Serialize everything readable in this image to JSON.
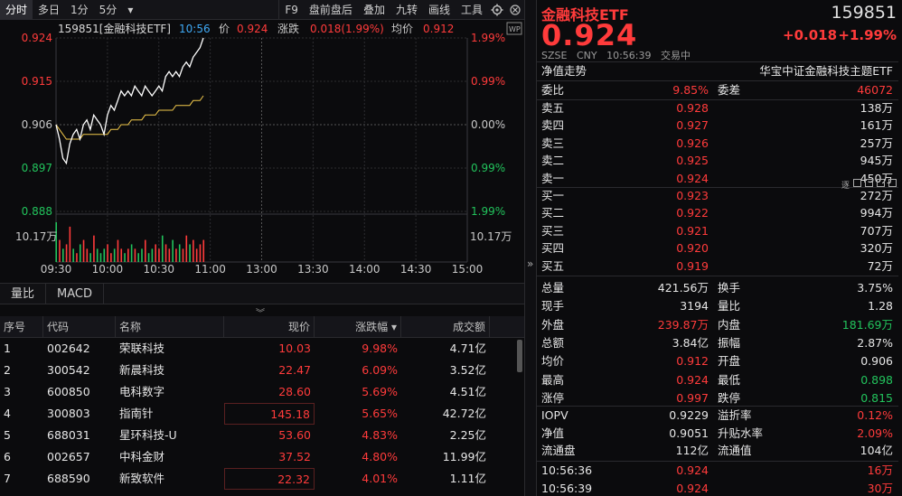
{
  "toolbar": {
    "tabs": [
      "分时",
      "多日",
      "1分",
      "5分"
    ],
    "dropdown": "▾",
    "tools": [
      "F9",
      "盘前盘后",
      "叠加",
      "九转",
      "画线",
      "工具"
    ]
  },
  "chart_header": {
    "name": "159851[金融科技ETF]",
    "time": "10:56",
    "price_label": "价",
    "price": "0.924",
    "change_label": "涨跌",
    "change": "0.018(1.99%)",
    "avg_label": "均价",
    "avg": "0.912",
    "badge": "WP"
  },
  "chart_axes": {
    "y_left": [
      "0.924",
      "0.915",
      "0.906",
      "0.897",
      "0.888"
    ],
    "y_right": [
      "1.99%",
      "0.99%",
      "0.00%",
      "0.99%",
      "1.99%"
    ],
    "vol_left": "10.17万",
    "vol_right": "10.17万",
    "x_ticks": [
      "09:30",
      "10:00",
      "10:30",
      "11:00",
      "13:00",
      "13:30",
      "14:00",
      "14:30",
      "15:00"
    ]
  },
  "chart_data": {
    "type": "line",
    "title": "",
    "xlabel": "",
    "ylabel": "",
    "ylim": [
      0.888,
      0.924
    ],
    "x": [
      "09:30",
      "09:32",
      "09:34",
      "09:36",
      "09:38",
      "09:40",
      "09:42",
      "09:44",
      "09:46",
      "09:48",
      "09:50",
      "09:52",
      "09:54",
      "09:56",
      "09:58",
      "10:00",
      "10:02",
      "10:04",
      "10:06",
      "10:08",
      "10:10",
      "10:12",
      "10:14",
      "10:16",
      "10:18",
      "10:20",
      "10:22",
      "10:24",
      "10:26",
      "10:28",
      "10:30",
      "10:32",
      "10:34",
      "10:36",
      "10:38",
      "10:40",
      "10:42",
      "10:44",
      "10:46",
      "10:48",
      "10:50",
      "10:52",
      "10:54",
      "10:56"
    ],
    "series": [
      {
        "values": [
          0.906,
          0.903,
          0.899,
          0.898,
          0.902,
          0.904,
          0.905,
          0.903,
          0.906,
          0.907,
          0.905,
          0.908,
          0.907,
          0.906,
          0.904,
          0.908,
          0.91,
          0.909,
          0.911,
          0.913,
          0.912,
          0.913,
          0.912,
          0.914,
          0.913,
          0.912,
          0.914,
          0.913,
          0.912,
          0.913,
          0.914,
          0.913,
          0.916,
          0.917,
          0.916,
          0.917,
          0.916,
          0.918,
          0.919,
          0.918,
          0.92,
          0.921,
          0.922,
          0.924
        ]
      },
      {
        "values": [
          0.906,
          0.905,
          0.904,
          0.903,
          0.903,
          0.903,
          0.903,
          0.903,
          0.904,
          0.904,
          0.904,
          0.904,
          0.904,
          0.904,
          0.904,
          0.904,
          0.905,
          0.905,
          0.905,
          0.906,
          0.906,
          0.906,
          0.907,
          0.907,
          0.907,
          0.907,
          0.908,
          0.908,
          0.908,
          0.908,
          0.909,
          0.909,
          0.909,
          0.909,
          0.909,
          0.91,
          0.91,
          0.91,
          0.91,
          0.91,
          0.911,
          0.911,
          0.911,
          0.912
        ]
      }
    ],
    "volume": [
      9,
      5,
      3,
      4,
      8,
      3,
      2,
      4,
      5,
      3,
      2,
      6,
      3,
      2,
      3,
      4,
      2,
      3,
      5,
      3,
      2,
      3,
      4,
      3,
      2,
      3,
      5,
      2,
      3,
      4,
      3,
      6,
      4,
      3,
      5,
      3,
      4,
      3,
      6,
      4,
      5,
      3,
      4,
      5
    ],
    "volume_colors": [
      "g",
      "r",
      "g",
      "r",
      "r",
      "g",
      "r",
      "g",
      "r",
      "r",
      "g",
      "r",
      "g",
      "g",
      "g",
      "r",
      "r",
      "g",
      "r",
      "r",
      "g",
      "r",
      "g",
      "r",
      "g",
      "g",
      "r",
      "g",
      "g",
      "r",
      "r",
      "g",
      "r",
      "r",
      "g",
      "r",
      "g",
      "r",
      "r",
      "g",
      "r",
      "r",
      "r",
      "r"
    ]
  },
  "indicators": [
    "量比",
    "MACD"
  ],
  "collapse_icon": "︾",
  "table": {
    "headers": [
      "序号",
      "代码",
      "名称",
      "现价",
      "涨跌幅",
      "成交额"
    ],
    "sort_icon": "▾",
    "rows": [
      {
        "no": "1",
        "code": "002642",
        "name": "荣联科技",
        "price": "10.03",
        "pct": "9.98%",
        "amount": "4.71亿"
      },
      {
        "no": "2",
        "code": "300542",
        "name": "新晨科技",
        "price": "22.47",
        "pct": "6.09%",
        "amount": "3.52亿"
      },
      {
        "no": "3",
        "code": "600850",
        "name": "电科数字",
        "price": "28.60",
        "pct": "5.69%",
        "amount": "4.51亿"
      },
      {
        "no": "4",
        "code": "300803",
        "name": "指南针",
        "price": "145.18",
        "pct": "5.65%",
        "amount": "42.72亿"
      },
      {
        "no": "5",
        "code": "688031",
        "name": "星环科技-U",
        "price": "53.60",
        "pct": "4.83%",
        "amount": "2.25亿"
      },
      {
        "no": "6",
        "code": "002657",
        "name": "中科金财",
        "price": "37.52",
        "pct": "4.80%",
        "amount": "11.99亿"
      },
      {
        "no": "7",
        "code": "688590",
        "name": "新致软件",
        "price": "22.32",
        "pct": "4.01%",
        "amount": "1.11亿"
      }
    ]
  },
  "divider_icon": "»",
  "quote": {
    "name": "金融科技ETF",
    "code": "159851",
    "price": "0.924",
    "change": "+0.018",
    "pct": "+1.99%",
    "market": "SZSE",
    "currency": "CNY",
    "time": "10:56:39",
    "status": "交易中",
    "nav_trend": "净值走势",
    "index_name": "华宝中证金融科技主题ETF",
    "wb_label": "委比",
    "wb": "9.85%",
    "wc_label": "委差",
    "wc": "46072",
    "asks": [
      {
        "label": "卖五",
        "price": "0.928",
        "vol": "138万"
      },
      {
        "label": "卖四",
        "price": "0.927",
        "vol": "161万"
      },
      {
        "label": "卖三",
        "price": "0.926",
        "vol": "257万"
      },
      {
        "label": "卖二",
        "price": "0.925",
        "vol": "945万"
      },
      {
        "label": "卖一",
        "price": "0.924",
        "vol": "450万"
      }
    ],
    "bids": [
      {
        "label": "买一",
        "price": "0.923",
        "vol": "272万"
      },
      {
        "label": "买二",
        "price": "0.922",
        "vol": "994万"
      },
      {
        "label": "买三",
        "price": "0.921",
        "vol": "707万"
      },
      {
        "label": "买四",
        "price": "0.920",
        "vol": "320万"
      },
      {
        "label": "买五",
        "price": "0.919",
        "vol": "72万"
      }
    ],
    "lots_label": "逐",
    "stats": [
      {
        "l1": "总量",
        "v1": "421.56万",
        "c1": "white",
        "l2": "换手",
        "v2": "3.75%",
        "c2": "white"
      },
      {
        "l1": "现手",
        "v1": "3194",
        "c1": "white",
        "l2": "量比",
        "v2": "1.28",
        "c2": "white"
      },
      {
        "l1": "外盘",
        "v1": "239.87万",
        "c1": "red",
        "l2": "内盘",
        "v2": "181.69万",
        "c2": "green"
      },
      {
        "l1": "总额",
        "v1": "3.84亿",
        "c1": "white",
        "l2": "振幅",
        "v2": "2.87%",
        "c2": "white"
      },
      {
        "l1": "均价",
        "v1": "0.912",
        "c1": "red",
        "l2": "开盘",
        "v2": "0.906",
        "c2": "white"
      },
      {
        "l1": "最高",
        "v1": "0.924",
        "c1": "red",
        "l2": "最低",
        "v2": "0.898",
        "c2": "green"
      },
      {
        "l1": "涨停",
        "v1": "0.997",
        "c1": "red",
        "l2": "跌停",
        "v2": "0.815",
        "c2": "green"
      }
    ],
    "etf": [
      {
        "l1": "IOPV",
        "v1": "0.9229",
        "c1": "white",
        "l2": "溢折率",
        "v2": "0.12%",
        "c2": "red"
      },
      {
        "l1": "净值",
        "v1": "0.9051",
        "c1": "white",
        "l2": "升贴水率",
        "v2": "2.09%",
        "c2": "red"
      },
      {
        "l1": "流通盘",
        "v1": "112亿",
        "c1": "white",
        "l2": "流通值",
        "v2": "104亿",
        "c2": "white"
      }
    ],
    "ticks": [
      {
        "time": "10:56:36",
        "price": "0.924",
        "vol": "16万"
      },
      {
        "time": "10:56:39",
        "price": "0.924",
        "vol": "30万"
      }
    ]
  }
}
